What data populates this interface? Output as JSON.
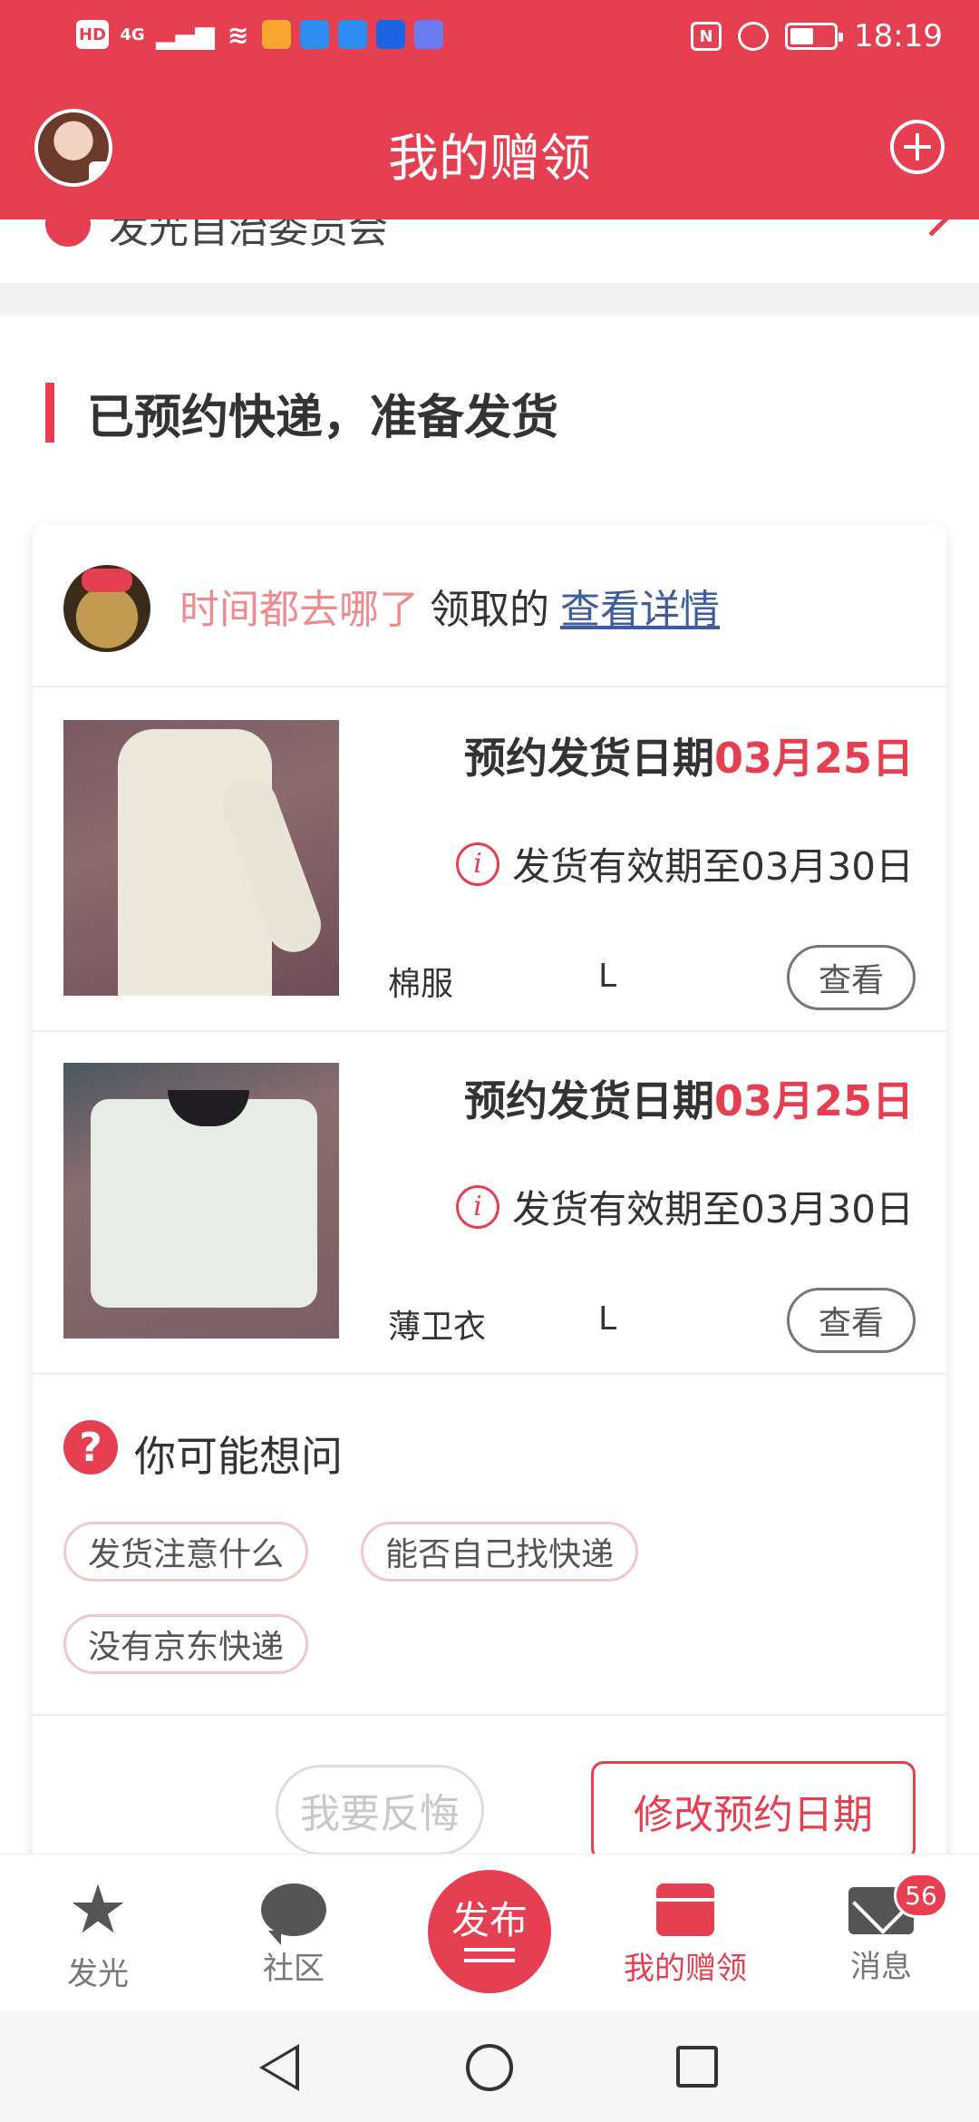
{
  "status_bar": {
    "time": "18:19",
    "left_chips": [
      "HD",
      "4G"
    ],
    "battery_level": 0.55
  },
  "header": {
    "title": "我的赠领",
    "avatar_icon": "user-avatar",
    "add_icon": "plus-circle-icon"
  },
  "cut_row": {
    "text": "发光自治委员会"
  },
  "section": {
    "title": "已预约快递，准备发货"
  },
  "claim": {
    "user": "时间都去哪了",
    "verb": "领取的",
    "link": "查看详情"
  },
  "items": [
    {
      "ship_label": "预约发货日期",
      "ship_date": "03月25日",
      "valid_text": "发货有效期至03月30日",
      "name": "棉服",
      "size": "L",
      "view_label": "查看"
    },
    {
      "ship_label": "预约发货日期",
      "ship_date": "03月25日",
      "valid_text": "发货有效期至03月30日",
      "name": "薄卫衣",
      "size": "L",
      "view_label": "查看"
    }
  ],
  "faq": {
    "title": "你可能想问",
    "chips": [
      "发货注意什么",
      "能否自己找快递",
      "没有京东快递"
    ]
  },
  "actions": {
    "regret": "我要反悔",
    "modify": "修改预约日期"
  },
  "bottom_nav": {
    "items": [
      {
        "label": "发光",
        "icon": "star-icon"
      },
      {
        "label": "社区",
        "icon": "chat-bubble-icon"
      },
      {
        "label": "我的赠领",
        "icon": "gift-box-icon",
        "active": true
      },
      {
        "label": "消息",
        "icon": "mail-icon",
        "badge": "56"
      }
    ],
    "publish_label": "发布"
  },
  "colors": {
    "brand": "#e53f51",
    "link": "#3e5d9b",
    "user_name": "#ef8a8f"
  }
}
